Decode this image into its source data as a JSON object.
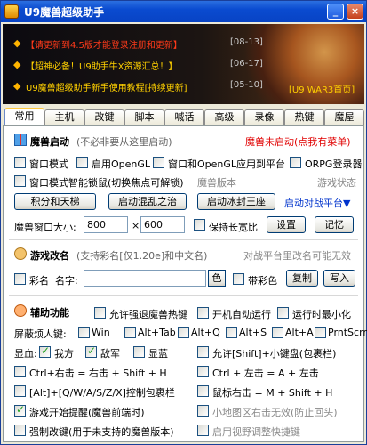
{
  "window": {
    "title": "U9魔兽超级助手",
    "min_label": "_",
    "close_label": "×"
  },
  "banner": {
    "news": [
      {
        "text": "【请更新到4.5版才能登录注册和更新】",
        "date": "[08-13]"
      },
      {
        "text": "【超神必备！U9助手牛X资源汇总！】",
        "date": "[06-17]"
      },
      {
        "text": "U9魔兽超级助手新手使用教程[持续更新]",
        "date": "[05-10]"
      }
    ],
    "home_link": "[U9 WAR3首页]"
  },
  "tabs": [
    "常用",
    "主机",
    "改键",
    "脚本",
    "喊话",
    "高级",
    "录像",
    "热键",
    "魔屋"
  ],
  "launch": {
    "title": "魔兽启动",
    "hint": "(不必非要从这里启动)",
    "status": "魔兽未启动(点我有菜单)",
    "window_mode": "窗口模式",
    "opengl": "启用OpenGL",
    "window_opengl_platform": "窗口和OpenGL应用到平台",
    "orpg": "ORPG登录器",
    "smart_lock": "窗口模式智能锁鼠(切换焦点可解锁)",
    "version_label": "魔兽版本",
    "game_status": "游戏状态",
    "ladder_btn": "积分和天梯",
    "chaos_btn": "启动混乱之治",
    "frozen_btn": "启动冰封王座",
    "platform_link": "启动对战平台▼",
    "size_label": "魔兽窗口大小:",
    "width": "800",
    "times": "×",
    "height": "600",
    "keep_ratio": "保持长宽比",
    "settings_btn": "设置",
    "remember_btn": "记忆"
  },
  "rename": {
    "title": "游戏改名",
    "hint": "(支持彩名[仅1.20e]和中文名)",
    "platform_hint": "对战平台里改名可能无效",
    "color_name": "彩名",
    "name_label": "名字:",
    "name_value": "",
    "color_btn": "色",
    "with_color": "带彩色",
    "copy_btn": "复制",
    "write_btn": "写入"
  },
  "aux": {
    "title": "辅助功能",
    "allow_force_exit": "允许强退魔兽热键",
    "auto_run": "开机自动运行",
    "minimize_on_run": "运行时最小化",
    "block_keys_label": "屏蔽烦人键:",
    "block_keys": [
      "Win",
      "Alt+Tab",
      "Alt+Q",
      "Alt+S",
      "Alt+A",
      "PrntScrn"
    ],
    "show_label": "显血:",
    "show_own": "我方",
    "show_enemy": "敌军",
    "show_shown": "显蓝",
    "allow_shift_keypad": "允许[Shift]+小键盘(包裹栏)",
    "ctrl_right": "Ctrl+右击 = 右击 + Shift + H",
    "ctrl_left": "Ctrl + 左击 = A + 左击",
    "alt_qwas": "[Alt]+[Q/W/A/S/Z/X]控制包裹栏",
    "mouse_right": "鼠标右击 = M + Shift + H",
    "start_remind": "游戏开始提醒(魔兽前端时)",
    "minimap_right": "小地图区右击无效(防止回头)",
    "force_remap": "强制改键(用于未支持的魔兽版本)",
    "enable_view": "启用视野调整快捷键"
  },
  "checked_states": {
    "show_own": true,
    "show_enemy": true,
    "start_remind": true
  }
}
